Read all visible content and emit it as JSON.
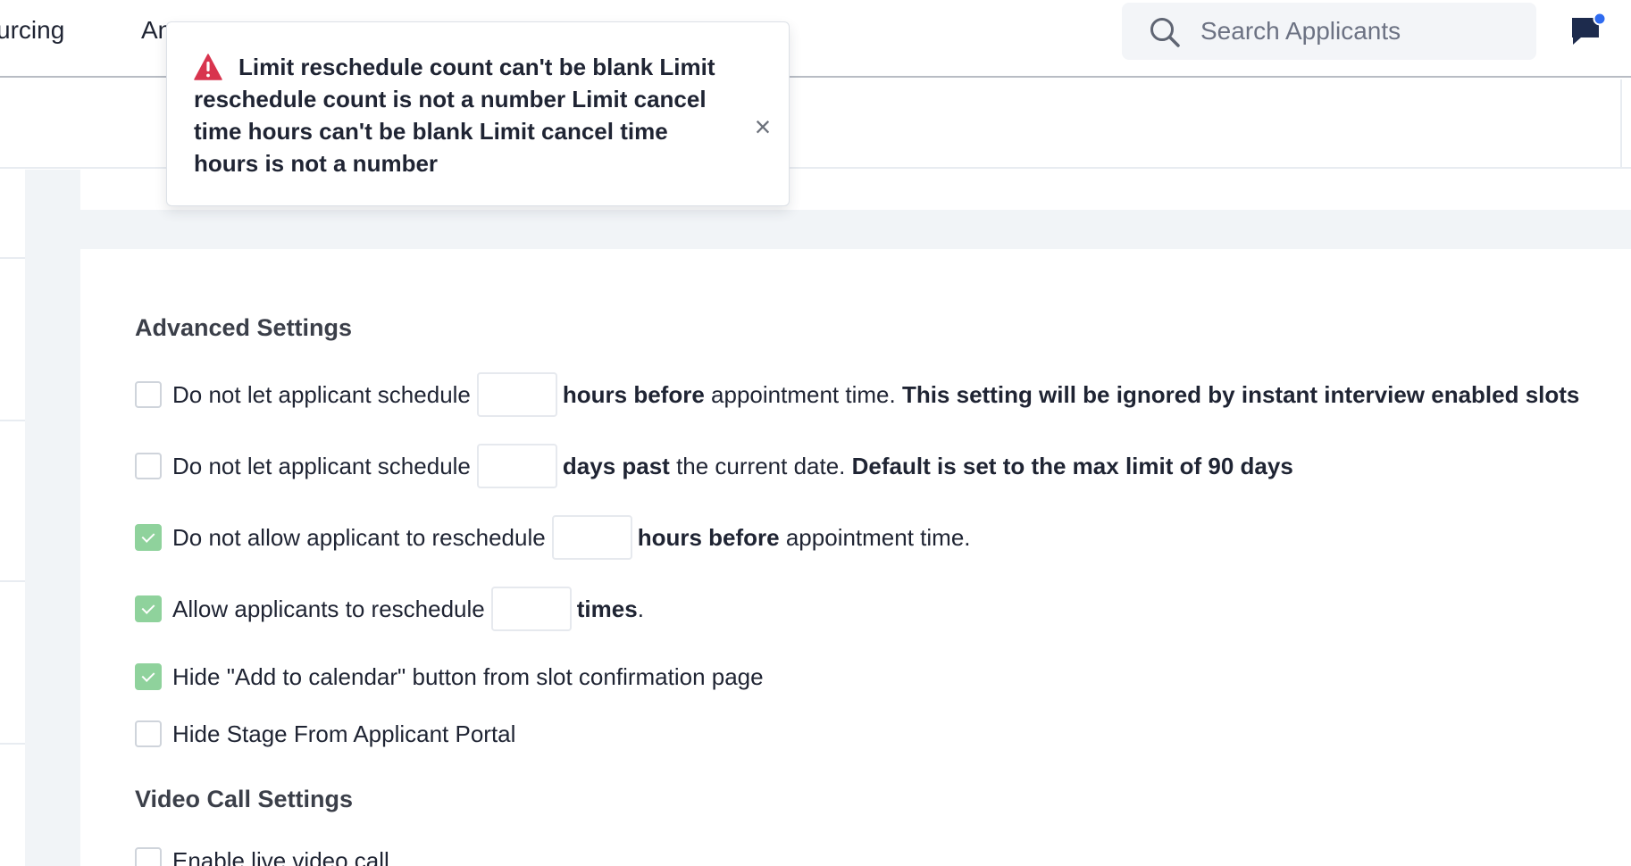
{
  "nav": {
    "items": [
      "urcing",
      "An"
    ],
    "search_placeholder": "Search Applicants"
  },
  "toast": {
    "message": "Limit reschedule count can't be blank Limit reschedule count is not a number Limit cancel time hours can't be blank Limit cancel time hours is not a number",
    "close_symbol": "×"
  },
  "advanced": {
    "title": "Advanced Settings",
    "rows": [
      {
        "checked": false,
        "before": "Do not let applicant schedule",
        "bold": "hours before",
        "after": " appointment time. ",
        "note": "This setting will be ignored by instant interview enabled slots",
        "value": ""
      },
      {
        "checked": false,
        "before": "Do not let applicant schedule",
        "bold": "days past",
        "after": " the current date. ",
        "note": "Default is set to the max limit of 90 days",
        "value": ""
      },
      {
        "checked": true,
        "before": "Do not allow applicant to reschedule",
        "bold": "hours before",
        "after": " appointment time.",
        "value": ""
      },
      {
        "checked": true,
        "before": "Allow applicants to reschedule",
        "bold": "times",
        "after": ".",
        "value": ""
      },
      {
        "checked": true,
        "label": "Hide \"Add to calendar\" button from slot confirmation page"
      },
      {
        "checked": false,
        "label": "Hide Stage From Applicant Portal"
      }
    ]
  },
  "video": {
    "title": "Video Call Settings",
    "rows": [
      {
        "checked": false,
        "label": "Enable live video call"
      }
    ]
  },
  "colors": {
    "checked": "#8fd29c",
    "alert_icon": "#d8344e",
    "chat_icon": "#1d2b4d",
    "notification_dot": "#2f6bf0"
  },
  "icons": {
    "search": "search-icon",
    "chat": "chat-icon",
    "alert": "alert-triangle-icon",
    "close": "close-icon",
    "check": "checkmark-icon"
  }
}
